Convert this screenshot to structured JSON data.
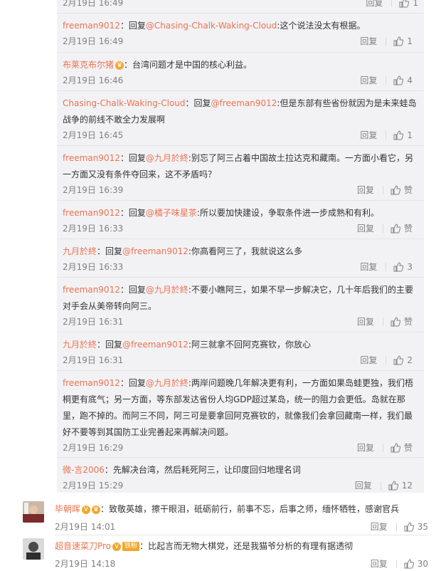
{
  "reply_label": "回复",
  "colon": "：",
  "replies": [
    {
      "user": "",
      "prefix": "",
      "mention": "",
      "content": "",
      "time": "2月19日 16:49",
      "like": "1"
    },
    {
      "user": "freeman9012",
      "prefix": "回复",
      "mention": "@Chasing-Chalk-Waking-Cloud",
      "content": ":这个说法没太有根据。",
      "time": "2月19日 16:49",
      "like": "1"
    },
    {
      "user": "布莱克布尔猪",
      "prefix": "",
      "mention": "",
      "content": "台湾问题才是中国的核心利益。",
      "time": "2月19日 16:46",
      "like": "4"
    },
    {
      "user": "Chasing-Chalk-Waking-Cloud",
      "prefix": "回复",
      "mention": "@freeman9012",
      "content": ":但是东部有些省份就因为是未来蛙岛战争的前线不敢全力发展啊",
      "time": "2月19日 16:45",
      "like": "1"
    },
    {
      "user": "freeman9012",
      "prefix": "回复",
      "mention": "@九月於終",
      "content": ":别忘了阿三占着中国故土拉达克和藏南。一方面小看它，另一方面又没有条件夺回来，这不矛盾吗？",
      "time": "2月19日 16:39",
      "like": "赞"
    },
    {
      "user": "freeman9012",
      "prefix": "回复",
      "mention": "@橘子味星茶",
      "content": ":所以要加快建设，争取条件进一步成熟和有利。",
      "time": "2月19日 16:33",
      "like": "赞"
    },
    {
      "user": "九月於終",
      "prefix": "回复",
      "mention": "@freeman9012",
      "content": ":你高看阿三了，我就说这么多",
      "time": "2月19日 16:33",
      "like": "3"
    },
    {
      "user": "freeman9012",
      "prefix": "回复",
      "mention": "@九月於終",
      "content": ":不要小瞧阿三，如果不早一步解决它，几十年后我们的主要对手会从美帝转向阿三。",
      "time": "2月19日 16:31",
      "like": "赞"
    },
    {
      "user": "九月於終",
      "prefix": "回复",
      "mention": "@freeman9012",
      "content": ":阿三就拿不回阿克赛钦，你放心",
      "time": "2月19日 16:31",
      "like": "2"
    },
    {
      "user": "freeman9012",
      "prefix": "回复",
      "mention": "@九月於終",
      "content": ":两岸问题晚几年解决更有利，一方面如果岛蛙更独，我们梧桐更有底气；另一方面，等东部发达省份人均GDP超过某岛，统一的阻力会更低。岛就在那里，跑不掉的。而阿三不同，阿三可是要拿回阿克赛钦的，就像我们会拿回藏南一样，我们最好不要等到其国防工业完善起来再解决问题。",
      "time": "2月19日 16:29",
      "like": "赞"
    },
    {
      "user": "微-言2006",
      "prefix": "",
      "mention": "",
      "content": "先解决台湾，然后耗死阿三，让印度回归地理名词",
      "time": "2月19日 15:29",
      "like": "12"
    }
  ],
  "comments": [
    {
      "user": "毕朝晖",
      "badge": "V",
      "content": "致敬英雄，擦干眼泪，砥砺前行，前事不忘，后事之师，缅怀牺牲，感谢官兵",
      "time": "2月19日 14:01",
      "like": "35"
    },
    {
      "user": "超音速菜刀Pro",
      "badge": "V",
      "tag": "铁粉",
      "content": "比起言而无物大棋党，还是我猫爷分析的有理有据透彻",
      "time": "2月19日 14:18",
      "like": "30"
    }
  ]
}
